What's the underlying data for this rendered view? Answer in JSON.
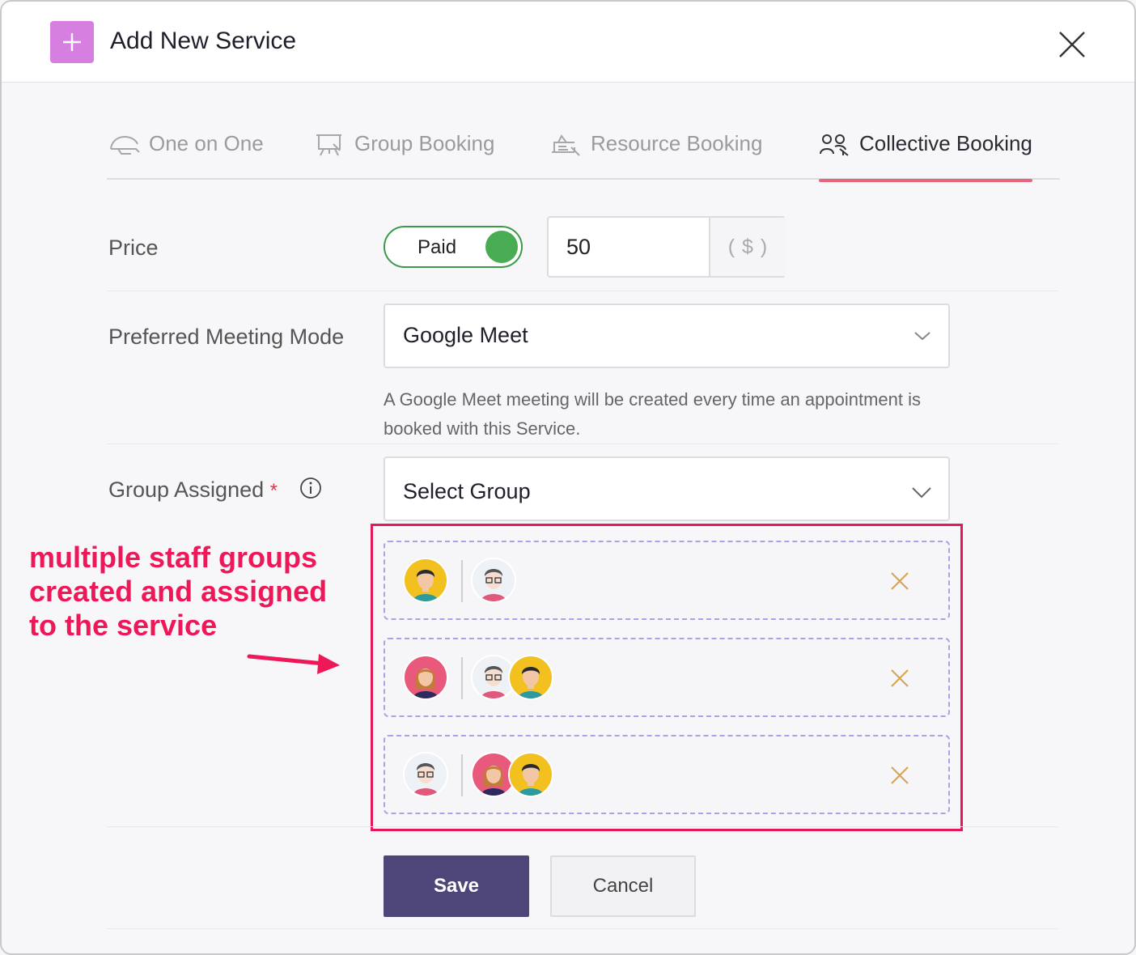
{
  "header": {
    "title": "Add New Service",
    "add_icon": "plus-icon",
    "close_icon": "close-icon",
    "accent_color": "#d67fe0"
  },
  "tabs": [
    {
      "label": "One on One",
      "icon": "one-on-one-icon",
      "active": false
    },
    {
      "label": "Group Booking",
      "icon": "group-booking-icon",
      "active": false
    },
    {
      "label": "Resource Booking",
      "icon": "resource-booking-icon",
      "active": false
    },
    {
      "label": "Collective Booking",
      "icon": "collective-booking-icon",
      "active": true
    }
  ],
  "price": {
    "label": "Price",
    "toggle_label": "Paid",
    "toggle_on": true,
    "amount": "50",
    "currency": "( $ )"
  },
  "meeting_mode": {
    "label": "Preferred Meeting Mode",
    "value": "Google Meet",
    "help_text": "A Google Meet meeting will be created every time an appointment is booked with this Service."
  },
  "group": {
    "label": "Group Assigned",
    "required_mark": "*",
    "placeholder": "Select Group",
    "groups": [
      {
        "lead": "man-yellow",
        "members": [
          "man-glasses"
        ]
      },
      {
        "lead": "woman-pink",
        "members": [
          "man-glasses",
          "man-yellow"
        ]
      },
      {
        "lead": "man-glasses",
        "members": [
          "woman-pink",
          "man-yellow"
        ]
      }
    ]
  },
  "annotation": {
    "line1": "multiple staff groups",
    "line2": "created and assigned",
    "line3": "to the service",
    "color": "#ee1858"
  },
  "actions": {
    "save": "Save",
    "cancel": "Cancel"
  }
}
